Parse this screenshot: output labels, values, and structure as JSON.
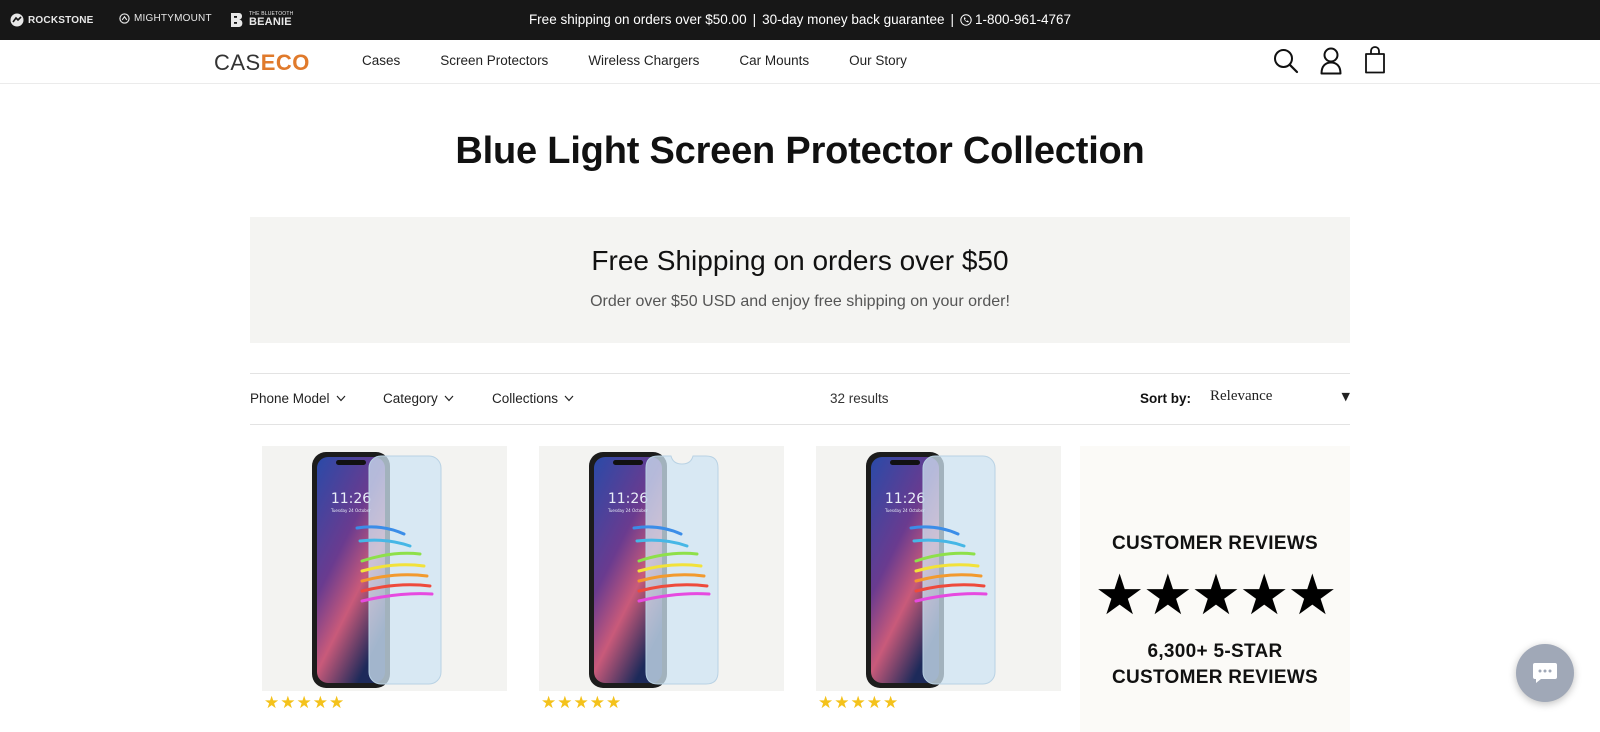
{
  "topbar": {
    "brands": [
      "ROCKSTONE",
      "MIGHTYMOUNT",
      "BEANIE"
    ],
    "beanie_small": "THE BLUETOOTH",
    "announcement": {
      "shipping": "Free shipping on orders over $50.00",
      "guarantee": "30-day money back guarantee",
      "phone": "1-800-961-4767"
    }
  },
  "nav": {
    "logo_part1": "CAS",
    "logo_part2": "ECO",
    "items": [
      "Cases",
      "Screen Protectors",
      "Wireless Chargers",
      "Car Mounts",
      "Our Story"
    ],
    "icons": [
      "search-icon",
      "account-icon",
      "cart-icon"
    ]
  },
  "page": {
    "title": "Blue Light Screen Protector Collection"
  },
  "banner": {
    "heading": "Free Shipping on orders over $50",
    "text": "Order over $50 USD and enjoy free shipping on your order!"
  },
  "filters": {
    "items": [
      "Phone Model",
      "Category",
      "Collections"
    ],
    "results": "32 results",
    "sort_label": "Sort by:",
    "sort_value": "Relevance"
  },
  "products": [
    {
      "rating_stars": "★★★★★",
      "screen_time": "11:26",
      "screen_date": "Tuesday 24 October"
    },
    {
      "rating_stars": "★★★★★",
      "screen_time": "11:26",
      "screen_date": "Tuesday 24 October"
    },
    {
      "rating_stars": "★★★★★",
      "screen_time": "11:26",
      "screen_date": "Tuesday 24 October"
    }
  ],
  "reviews": {
    "title": "CUSTOMER REVIEWS",
    "stars": "★★★★★",
    "count_line1": "6,300+ 5-STAR",
    "count_line2": "CUSTOMER REVIEWS"
  },
  "colors": {
    "topbar_bg": "#171717",
    "logo_accent": "#e07a2b",
    "banner_bg": "#f4f4f2",
    "star_gold": "#f4c21b",
    "chat_bg": "#a0a8b7"
  }
}
